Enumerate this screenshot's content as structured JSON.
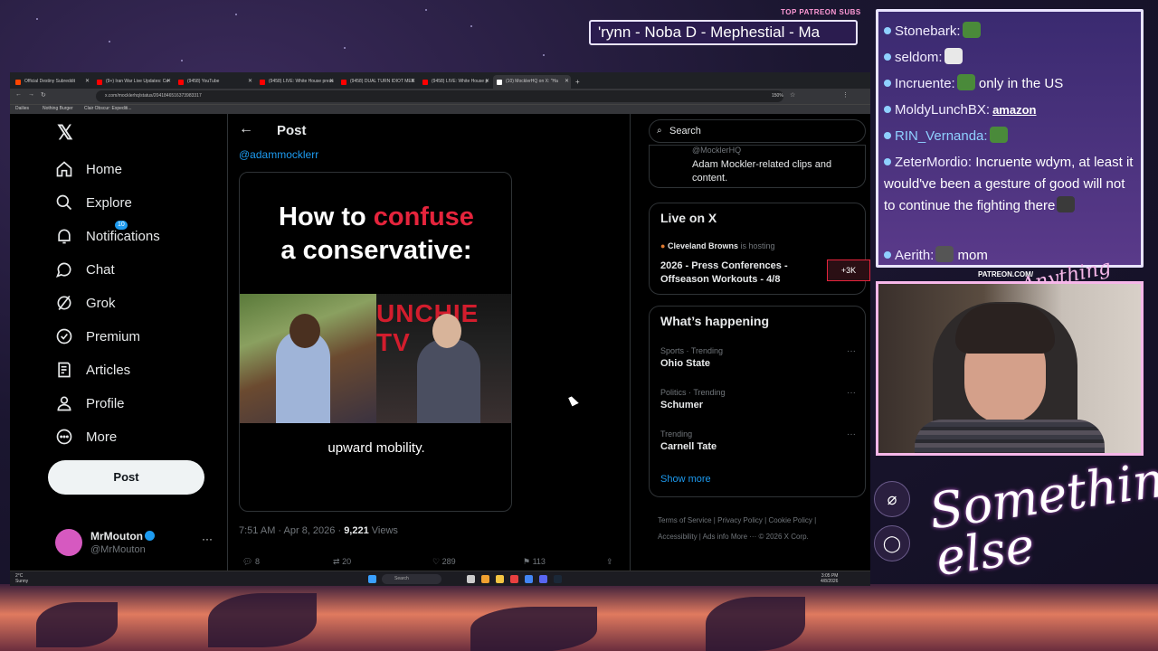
{
  "overlay": {
    "patreon_subs_label": "TOP PATREON SUBS",
    "ticker_text": "'rynn -  Noba D - Mephestial - Ma",
    "patreon_url": "PATREON.COM/",
    "anything_else_text": "Anything else?",
    "something_else_text": "Something else"
  },
  "browser": {
    "tabs": [
      {
        "label": "Official Destiny Subreddit",
        "color": "#ff4500"
      },
      {
        "label": "(9+) Iran War Live Updates: Ce",
        "color": "#ff0000"
      },
      {
        "label": "(9458) YouTube",
        "color": "#ff0000"
      },
      {
        "label": "(9458) LIVE: White House press",
        "color": "#ff0000"
      },
      {
        "label": "(9458) DUAL TURN IDIOT MEE",
        "color": "#ff0000"
      },
      {
        "label": "(9458) LIVE: White House p",
        "color": "#ff0000"
      },
      {
        "label": "(10) MocklerHQ on X: \"Ha",
        "color": "#ffffff"
      }
    ],
    "url": "x.com/mocklerhq/status/2041846516373983317",
    "zoom": "150%",
    "bookmarks": [
      "Dailies",
      "Nothing Burger",
      "Clair Obscur: Expediti..."
    ]
  },
  "x": {
    "nav": [
      {
        "label": "Home",
        "icon": "home-icon"
      },
      {
        "label": "Explore",
        "icon": "search-icon"
      },
      {
        "label": "Notifications",
        "icon": "bell-icon",
        "badge": "10"
      },
      {
        "label": "Chat",
        "icon": "chat-icon"
      },
      {
        "label": "Grok",
        "icon": "grok-icon"
      },
      {
        "label": "Premium",
        "icon": "premium-icon"
      },
      {
        "label": "Articles",
        "icon": "articles-icon"
      },
      {
        "label": "Profile",
        "icon": "profile-icon"
      },
      {
        "label": "More",
        "icon": "more-icon"
      }
    ],
    "post_button": "Post",
    "account": {
      "name": "MrMouton",
      "handle": "@MrMouton"
    },
    "post_header": "Post",
    "mention": "@adammocklerr",
    "media": {
      "line1_a": "How to ",
      "line1_b": "confuse",
      "line2": "a conservative:",
      "sign": "UNCHIE TV",
      "caption": "upward mobility."
    },
    "post_time": "7:51 AM · Apr 8, 2026 · ",
    "views_count": "9,221",
    "views_label": " Views",
    "actions": {
      "replies": "8",
      "reposts": "20",
      "likes": "289",
      "bookmarks": "113"
    },
    "search_placeholder": "Search",
    "about_text": "Adam Mockler-related clips and content.",
    "about_handle": "@MocklerHQ",
    "live": {
      "title": "Live on X",
      "host": "Cleveland Browns",
      "host_suffix": " is hosting",
      "event": "2026 - Press Conferences - Offseason Workouts - 4/8",
      "count": "+3K"
    },
    "happening": {
      "title": "What’s happening",
      "trends": [
        {
          "category": "Sports · Trending",
          "name": "Ohio State"
        },
        {
          "category": "Politics · Trending",
          "name": "Schumer"
        },
        {
          "category": "Trending",
          "name": "Carnell Tate"
        }
      ],
      "show_more": "Show more"
    },
    "footer": {
      "links": [
        "Terms of Service",
        "Privacy Policy",
        "Cookie Policy",
        "Accessibility",
        "Ads info",
        "More ···"
      ],
      "copyright": "© 2026 X Corp."
    }
  },
  "taskbar": {
    "weather_temp": "2°C",
    "weather_desc": "Sunny",
    "search": "Search",
    "time": "3:05 PM",
    "date": "4/8/2026"
  },
  "chat": [
    {
      "user": "Stonebark:",
      "text": ""
    },
    {
      "user": "seldom:",
      "text": ""
    },
    {
      "user": "Incruente:",
      "text": " only in the US"
    },
    {
      "user": "MoldyLunchBX:",
      "text": "amazon"
    },
    {
      "user": "RIN_Vernanda:",
      "text": ""
    },
    {
      "user": "ZeterMordio:",
      "text": " Incruente wdym, at least it would've been a gesture of good will not to continue the fighting there"
    },
    {
      "user": "Aerith:",
      "text": " mom"
    }
  ]
}
